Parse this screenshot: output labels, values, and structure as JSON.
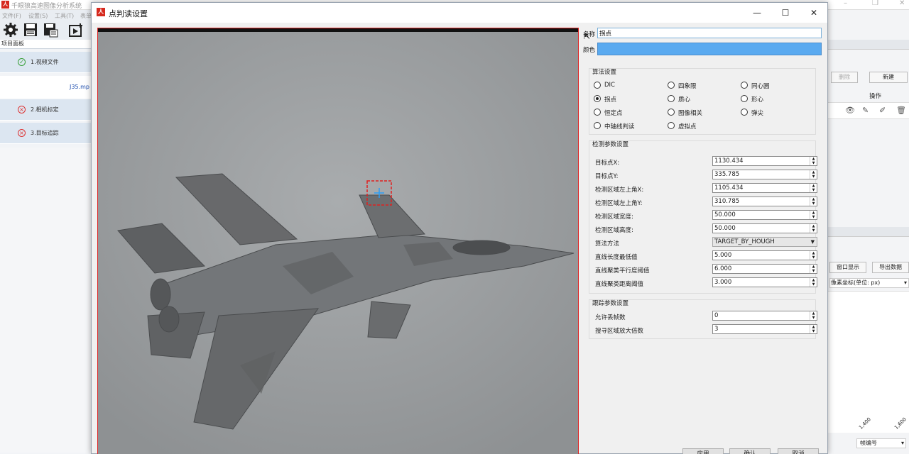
{
  "main_window": {
    "title": "千眼狼高速图像分析系统",
    "menu": [
      "文件(F)",
      "设置(S)",
      "工具(T)",
      "表单"
    ],
    "left_panel": {
      "header": "项目面板",
      "items": [
        {
          "label": "1.视频文件",
          "status": "ok"
        },
        {
          "label": "2.相机标定",
          "status": "error"
        },
        {
          "label": "3.目标追踪",
          "status": "error"
        }
      ],
      "file": "J35.mp"
    },
    "right_panel": {
      "delete_label": "删除",
      "new_label": "新建",
      "ops_header": "操作",
      "window_show_label": "窗口显示",
      "export_label": "导出数据",
      "coord_label": "像素坐标(单位: px)",
      "frame_label": "帧编号",
      "ticks": [
        "1,400",
        "1,600"
      ]
    }
  },
  "dialog": {
    "title": "点判读设置",
    "name_label": "名称",
    "name_value": "拐点",
    "color_label": "颜色",
    "color_value": "#5aaaf0",
    "algorithm_group": {
      "title": "算法设置",
      "options": [
        "DIC",
        "四象限",
        "同心圆",
        "拐点",
        "质心",
        "形心",
        "恒定点",
        "图像相关",
        "弹尖",
        "中轴线判读",
        "虚拟点"
      ],
      "selected": "拐点"
    },
    "detect_group": {
      "title": "检测参数设置",
      "params": [
        {
          "label": "目标点X:",
          "value": "1130.434"
        },
        {
          "label": "目标点Y:",
          "value": "335.785"
        },
        {
          "label": "检测区域左上角X:",
          "value": "1105.434"
        },
        {
          "label": "检测区域左上角Y:",
          "value": "310.785"
        },
        {
          "label": "检测区域宽度:",
          "value": "50.000"
        },
        {
          "label": "检测区域高度:",
          "value": "50.000"
        }
      ],
      "method_label": "算法方法",
      "method_value": "TARGET_BY_HOUGH",
      "params2": [
        {
          "label": "直线长度最低值",
          "value": "5.000"
        },
        {
          "label": "直线聚类平行度阈值",
          "value": "6.000"
        },
        {
          "label": "直线聚类距离阈值",
          "value": "3.000"
        }
      ]
    },
    "track_group": {
      "title": "跟踪参数设置",
      "params": [
        {
          "label": "允许丢帧数",
          "value": "0"
        },
        {
          "label": "搜寻区域放大倍数",
          "value": "3"
        }
      ]
    },
    "buttons": [
      "应用",
      "确认",
      "取消"
    ]
  }
}
